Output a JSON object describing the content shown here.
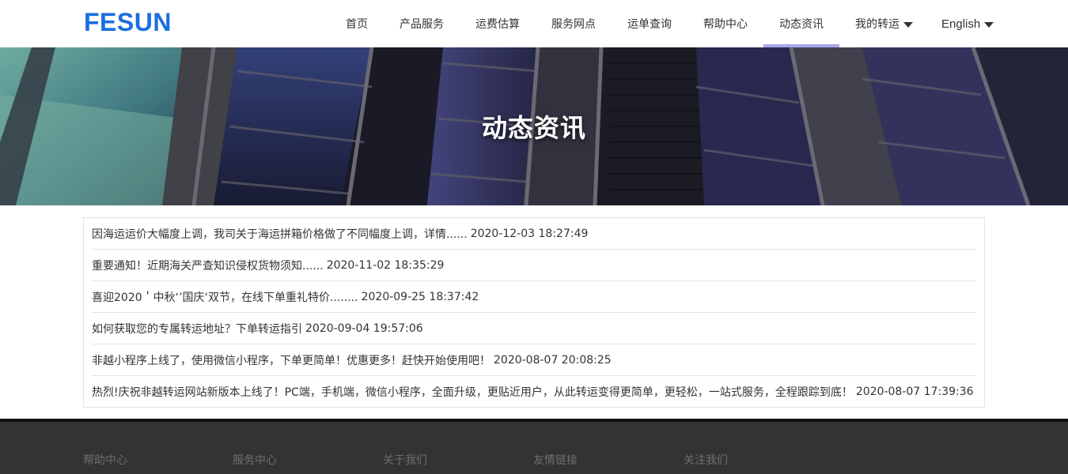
{
  "header": {
    "logo": "FESUN",
    "nav": [
      {
        "label": "首页"
      },
      {
        "label": "产品服务"
      },
      {
        "label": "运费估算"
      },
      {
        "label": "服务网点"
      },
      {
        "label": "运单查询"
      },
      {
        "label": "帮助中心"
      },
      {
        "label": "动态资讯",
        "active": true
      },
      {
        "label": "我的转运",
        "dropdown": true
      },
      {
        "label": "English",
        "dropdown": true
      }
    ]
  },
  "banner": {
    "title": "动态资讯"
  },
  "news": [
    {
      "title": "因海运运价大幅度上调，我司关于海运拼箱价格做了不同幅度上调，详情......",
      "date": "2020-12-03 18:27:49"
    },
    {
      "title": "重要通知！近期海关严查知识侵权货物须知......",
      "date": "2020-11-02 18:35:29"
    },
    {
      "title": "喜迎2020＇中秋‘’国庆‘双节，在线下单重礼特价........",
      "date": "2020-09-25 18:37:42"
    },
    {
      "title": "如何获取您的专属转运地址？下单转运指引",
      "date": "2020-09-04 19:57:06"
    },
    {
      "title": "非越小程序上线了，使用微信小程序，下单更简单！优惠更多！赶快开始使用吧！",
      "date": "2020-08-07 20:08:25"
    },
    {
      "title": "热烈!庆祝非越转运网站新版本上线了！PC端，手机端，微信小程序，全面升级，更贴近用户，从此转运变得更简单，更轻松，一站式服务，全程跟踪到底！",
      "date": "2020-08-07 17:39:36"
    }
  ],
  "footer": {
    "columns": [
      "帮助中心",
      "服务中心",
      "关于我们",
      "友情链接",
      "关注我们"
    ]
  },
  "colors": {
    "logo": "#1a6fe0",
    "nav_active_underline": "#aaa7ec",
    "footer_bg": "#333333"
  }
}
